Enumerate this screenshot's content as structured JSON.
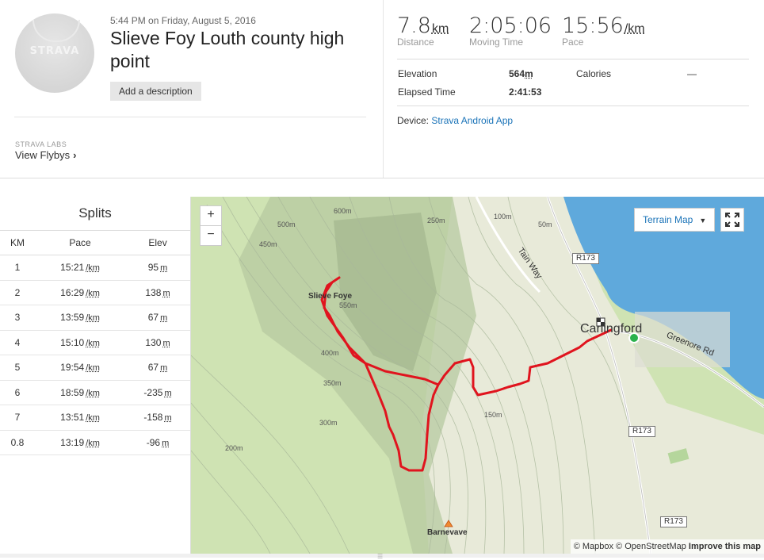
{
  "activity": {
    "date": "5:44 PM on Friday, August 5, 2016",
    "title": "Slieve Foy Louth county high point",
    "add_description": "Add a description",
    "avatar_logo": "STRAVA"
  },
  "labs": {
    "label": "STRAVA LABS",
    "link": "View Flybys",
    "chevron": "›"
  },
  "stats": {
    "distance": {
      "value": "7.8",
      "unit": "km",
      "label": "Distance"
    },
    "moving_time": {
      "value": "2:05:06",
      "label": "Moving Time"
    },
    "pace": {
      "value": "15:56",
      "unit": "/km",
      "label": "Pace"
    },
    "elevation_label": "Elevation",
    "elevation_value": "564",
    "elevation_unit": "m",
    "calories_label": "Calories",
    "calories_value": "—",
    "elapsed_label": "Elapsed Time",
    "elapsed_value": "2:41:53",
    "device_label": "Device:",
    "device_value": "Strava Android App"
  },
  "splits": {
    "title": "Splits",
    "headers": [
      "KM",
      "Pace",
      "Elev"
    ],
    "pace_unit": "/km",
    "elev_unit": "m",
    "rows": [
      {
        "km": "1",
        "pace": "15:21",
        "elev": "95"
      },
      {
        "km": "2",
        "pace": "16:29",
        "elev": "138"
      },
      {
        "km": "3",
        "pace": "13:59",
        "elev": "67"
      },
      {
        "km": "4",
        "pace": "15:10",
        "elev": "130"
      },
      {
        "km": "5",
        "pace": "19:54",
        "elev": "67"
      },
      {
        "km": "6",
        "pace": "18:59",
        "elev": "-235"
      },
      {
        "km": "7",
        "pace": "13:51",
        "elev": "-158"
      },
      {
        "km": "0.8",
        "pace": "13:19",
        "elev": "-96"
      }
    ]
  },
  "map": {
    "zoom_in": "+",
    "zoom_out": "−",
    "terrain_button": "Terrain Map",
    "attribution_1": "© Mapbox © OpenStreetMap",
    "attribution_2": "Improve this map",
    "labels": {
      "peak": "Slieve Foye",
      "town": "Carlingford",
      "barnevave": "Barnevave",
      "road1": "R173",
      "road2": "R173",
      "road3": "R173",
      "greenore": "Greenore Rd",
      "tain": "Tain Way",
      "c600": "600m",
      "c550": "550m",
      "c500": "500m",
      "c450": "450m",
      "c400": "400m",
      "c350": "350m",
      "c300": "300m",
      "c250": "250m",
      "c200": "200m",
      "c150": "150m",
      "c100": "100m",
      "c50": "50m"
    },
    "colors": {
      "route": "#e0141e",
      "sea": "#5fa9dc",
      "terrain": "#cfe3b3",
      "start": "#2bb24c"
    }
  }
}
